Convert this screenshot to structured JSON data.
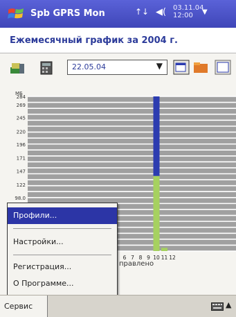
{
  "window": {
    "app_title": "Spb GPRS Mon",
    "signal_glyph": "↑↓",
    "clock_date": "03.11.04",
    "clock_time": "12:00"
  },
  "heading": "Ежемесячный график за 2004 г.",
  "toolbar": {
    "date_value": "22.05.04",
    "icons": [
      "monitor-icon",
      "calculator-icon",
      "list-view-icon",
      "folder-icon",
      "chart-view-icon"
    ]
  },
  "chart_data": {
    "type": "bar",
    "ylabel": "МБ",
    "y_ticks": [
      "284",
      "269",
      "245",
      "220",
      "196",
      "171",
      "147",
      "122",
      "98.0"
    ],
    "x_ticks": [
      "6",
      "7",
      "8",
      "9",
      "10",
      "11",
      "12"
    ],
    "x_caption": "правлено",
    "categories": [
      "10",
      "11"
    ],
    "series": [
      {
        "color": "#2c3cb0",
        "values": [
          146,
          0
        ]
      },
      {
        "color": "#a6d160",
        "values": [
          138,
          6
        ]
      }
    ],
    "ylim": [
      0,
      284
    ],
    "grid": true,
    "stacked": true
  },
  "menu": {
    "items": [
      "Профили...",
      "Настройки...",
      "Регистрация...",
      "О Программе..."
    ],
    "selected": 0
  },
  "bottom": {
    "service_label": "Сервис"
  },
  "colors": {
    "titlebar": "#4a52c8",
    "heading_text": "#2c3b9a",
    "menu_selected": "#2c35a6"
  }
}
